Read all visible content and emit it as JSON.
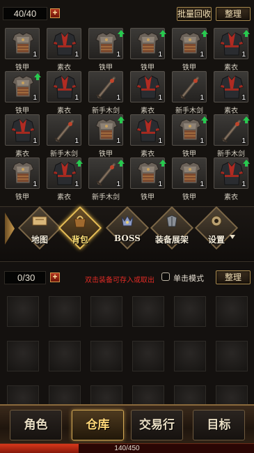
{
  "bag": {
    "count": "40/40",
    "plus_label": "+",
    "batch_recycle_label": "批量回收",
    "sort_label": "整理",
    "items": [
      {
        "name": "铁甲",
        "type": "armor",
        "qty": "1",
        "upgrade": false
      },
      {
        "name": "素衣",
        "type": "robe",
        "qty": "1",
        "upgrade": false
      },
      {
        "name": "铁甲",
        "type": "armor",
        "qty": "1",
        "upgrade": true
      },
      {
        "name": "铁甲",
        "type": "armor",
        "qty": "1",
        "upgrade": true
      },
      {
        "name": "铁甲",
        "type": "armor",
        "qty": "1",
        "upgrade": true
      },
      {
        "name": "素衣",
        "type": "robe",
        "qty": "1",
        "upgrade": true
      },
      {
        "name": "铁甲",
        "type": "armor",
        "qty": "1",
        "upgrade": true
      },
      {
        "name": "素衣",
        "type": "robe",
        "qty": "1",
        "upgrade": false
      },
      {
        "name": "新手木剑",
        "type": "sword",
        "qty": "1",
        "upgrade": false
      },
      {
        "name": "素衣",
        "type": "robe",
        "qty": "1",
        "upgrade": false
      },
      {
        "name": "新手木剑",
        "type": "sword",
        "qty": "1",
        "upgrade": false
      },
      {
        "name": "素衣",
        "type": "robe",
        "qty": "1",
        "upgrade": false
      },
      {
        "name": "素衣",
        "type": "robe",
        "qty": "1",
        "upgrade": false
      },
      {
        "name": "新手木剑",
        "type": "sword",
        "qty": "1",
        "upgrade": false
      },
      {
        "name": "铁甲",
        "type": "armor",
        "qty": "1",
        "upgrade": true
      },
      {
        "name": "素衣",
        "type": "robe",
        "qty": "1",
        "upgrade": false
      },
      {
        "name": "铁甲",
        "type": "armor",
        "qty": "1",
        "upgrade": true
      },
      {
        "name": "新手木剑",
        "type": "sword",
        "qty": "1",
        "upgrade": true
      },
      {
        "name": "铁甲",
        "type": "armor",
        "qty": "1",
        "upgrade": false
      },
      {
        "name": "素衣",
        "type": "robe",
        "qty": "1",
        "upgrade": true
      },
      {
        "name": "新手木剑",
        "type": "sword",
        "qty": "1",
        "upgrade": true
      },
      {
        "name": "铁甲",
        "type": "armor",
        "qty": "1",
        "upgrade": true
      },
      {
        "name": "铁甲",
        "type": "armor",
        "qty": "1",
        "upgrade": false
      },
      {
        "name": "素衣",
        "type": "robe",
        "qty": "1",
        "upgrade": true
      }
    ]
  },
  "menu": {
    "items": [
      {
        "label": "地图",
        "icon": "scroll-map-icon",
        "active": false
      },
      {
        "label": "背包",
        "icon": "bag-icon",
        "active": true
      },
      {
        "label": "BOSS",
        "icon": "boss-icon",
        "active": false
      },
      {
        "label": "装备展架",
        "icon": "armor-rack-icon",
        "active": false
      },
      {
        "label": "设置",
        "icon": "settings-icon",
        "active": false
      }
    ]
  },
  "warehouse": {
    "count": "0/30",
    "plus_label": "+",
    "hint": "双击装备可存入或取出",
    "single_click_label": "单击模式",
    "sort_label": "整理",
    "visible_slots": 18
  },
  "nav": {
    "tabs": [
      {
        "label": "角色",
        "active": false
      },
      {
        "label": "仓库",
        "active": true
      },
      {
        "label": "交易行",
        "active": false
      },
      {
        "label": "目标",
        "active": false
      }
    ]
  },
  "xp": {
    "text": "140/450",
    "fraction": 0.31
  },
  "colors": {
    "upgrade_arrow": "#27c94f",
    "hint_red": "#e02b25",
    "accent_gold": "#e8bf57"
  }
}
